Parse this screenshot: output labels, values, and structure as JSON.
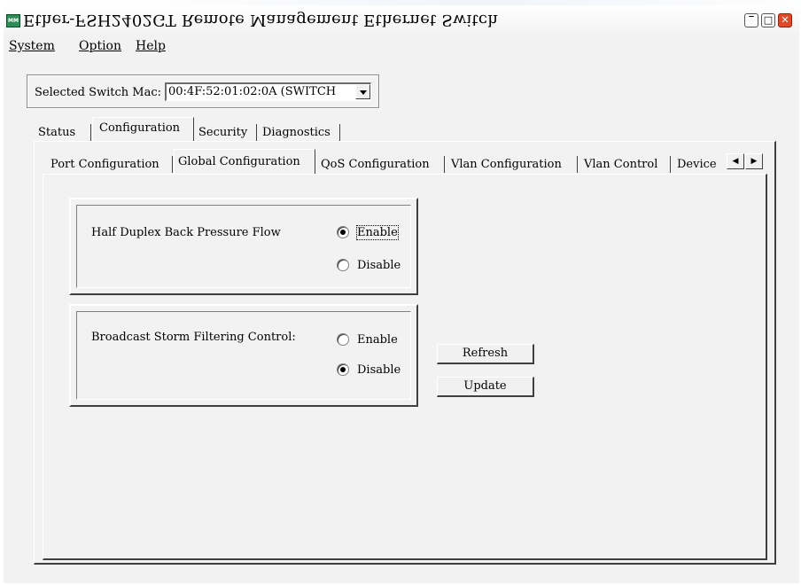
{
  "window": {
    "title": "Ether-FSH2402GT Remote Management Ethernet Switch",
    "app_icon": "MM",
    "controls": {
      "minimize": "‾",
      "maximize": "□",
      "close": "✕"
    }
  },
  "menu": [
    "System",
    "Option",
    "Help"
  ],
  "mac_selector": {
    "label": "Selected Switch Mac:",
    "value": "00:4F:52:01:02:0A (SWITCH"
  },
  "main_tabs": [
    {
      "label": "Status"
    },
    {
      "label": "Configuration",
      "active": true
    },
    {
      "label": "Security"
    },
    {
      "label": "Diagnostics"
    }
  ],
  "sub_tabs": [
    {
      "label": "Port Configuration"
    },
    {
      "label": "Global Configuration",
      "active": true
    },
    {
      "label": "QoS Configuration"
    },
    {
      "label": "Vlan Configuration"
    },
    {
      "label": "Vlan Control"
    },
    {
      "label": "Device"
    }
  ],
  "tab_scroll": {
    "left": "◀",
    "right": "▶"
  },
  "half_duplex": {
    "label": "Half Duplex Back Pressure Flow",
    "options": [
      "Enable",
      "Disable"
    ],
    "selected": "Enable"
  },
  "broadcast_storm": {
    "label": "Broadcast Storm Filtering Control:",
    "options": [
      "Enable",
      "Disable"
    ],
    "selected": "Disable"
  },
  "buttons": {
    "refresh": "Refresh",
    "update": "Update"
  }
}
